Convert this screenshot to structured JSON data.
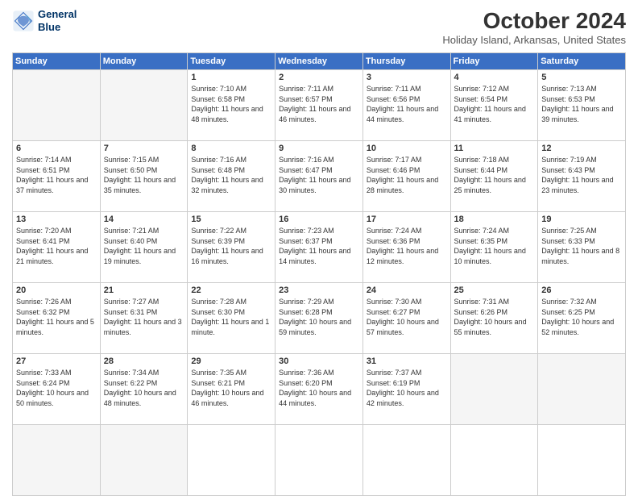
{
  "header": {
    "logo_line1": "General",
    "logo_line2": "Blue",
    "title": "October 2024",
    "location": "Holiday Island, Arkansas, United States"
  },
  "weekdays": [
    "Sunday",
    "Monday",
    "Tuesday",
    "Wednesday",
    "Thursday",
    "Friday",
    "Saturday"
  ],
  "days": [
    {
      "num": "",
      "info": ""
    },
    {
      "num": "",
      "info": ""
    },
    {
      "num": "1",
      "info": "Sunrise: 7:10 AM\nSunset: 6:58 PM\nDaylight: 11 hours and 48 minutes."
    },
    {
      "num": "2",
      "info": "Sunrise: 7:11 AM\nSunset: 6:57 PM\nDaylight: 11 hours and 46 minutes."
    },
    {
      "num": "3",
      "info": "Sunrise: 7:11 AM\nSunset: 6:56 PM\nDaylight: 11 hours and 44 minutes."
    },
    {
      "num": "4",
      "info": "Sunrise: 7:12 AM\nSunset: 6:54 PM\nDaylight: 11 hours and 41 minutes."
    },
    {
      "num": "5",
      "info": "Sunrise: 7:13 AM\nSunset: 6:53 PM\nDaylight: 11 hours and 39 minutes."
    },
    {
      "num": "6",
      "info": "Sunrise: 7:14 AM\nSunset: 6:51 PM\nDaylight: 11 hours and 37 minutes."
    },
    {
      "num": "7",
      "info": "Sunrise: 7:15 AM\nSunset: 6:50 PM\nDaylight: 11 hours and 35 minutes."
    },
    {
      "num": "8",
      "info": "Sunrise: 7:16 AM\nSunset: 6:48 PM\nDaylight: 11 hours and 32 minutes."
    },
    {
      "num": "9",
      "info": "Sunrise: 7:16 AM\nSunset: 6:47 PM\nDaylight: 11 hours and 30 minutes."
    },
    {
      "num": "10",
      "info": "Sunrise: 7:17 AM\nSunset: 6:46 PM\nDaylight: 11 hours and 28 minutes."
    },
    {
      "num": "11",
      "info": "Sunrise: 7:18 AM\nSunset: 6:44 PM\nDaylight: 11 hours and 25 minutes."
    },
    {
      "num": "12",
      "info": "Sunrise: 7:19 AM\nSunset: 6:43 PM\nDaylight: 11 hours and 23 minutes."
    },
    {
      "num": "13",
      "info": "Sunrise: 7:20 AM\nSunset: 6:41 PM\nDaylight: 11 hours and 21 minutes."
    },
    {
      "num": "14",
      "info": "Sunrise: 7:21 AM\nSunset: 6:40 PM\nDaylight: 11 hours and 19 minutes."
    },
    {
      "num": "15",
      "info": "Sunrise: 7:22 AM\nSunset: 6:39 PM\nDaylight: 11 hours and 16 minutes."
    },
    {
      "num": "16",
      "info": "Sunrise: 7:23 AM\nSunset: 6:37 PM\nDaylight: 11 hours and 14 minutes."
    },
    {
      "num": "17",
      "info": "Sunrise: 7:24 AM\nSunset: 6:36 PM\nDaylight: 11 hours and 12 minutes."
    },
    {
      "num": "18",
      "info": "Sunrise: 7:24 AM\nSunset: 6:35 PM\nDaylight: 11 hours and 10 minutes."
    },
    {
      "num": "19",
      "info": "Sunrise: 7:25 AM\nSunset: 6:33 PM\nDaylight: 11 hours and 8 minutes."
    },
    {
      "num": "20",
      "info": "Sunrise: 7:26 AM\nSunset: 6:32 PM\nDaylight: 11 hours and 5 minutes."
    },
    {
      "num": "21",
      "info": "Sunrise: 7:27 AM\nSunset: 6:31 PM\nDaylight: 11 hours and 3 minutes."
    },
    {
      "num": "22",
      "info": "Sunrise: 7:28 AM\nSunset: 6:30 PM\nDaylight: 11 hours and 1 minute."
    },
    {
      "num": "23",
      "info": "Sunrise: 7:29 AM\nSunset: 6:28 PM\nDaylight: 10 hours and 59 minutes."
    },
    {
      "num": "24",
      "info": "Sunrise: 7:30 AM\nSunset: 6:27 PM\nDaylight: 10 hours and 57 minutes."
    },
    {
      "num": "25",
      "info": "Sunrise: 7:31 AM\nSunset: 6:26 PM\nDaylight: 10 hours and 55 minutes."
    },
    {
      "num": "26",
      "info": "Sunrise: 7:32 AM\nSunset: 6:25 PM\nDaylight: 10 hours and 52 minutes."
    },
    {
      "num": "27",
      "info": "Sunrise: 7:33 AM\nSunset: 6:24 PM\nDaylight: 10 hours and 50 minutes."
    },
    {
      "num": "28",
      "info": "Sunrise: 7:34 AM\nSunset: 6:22 PM\nDaylight: 10 hours and 48 minutes."
    },
    {
      "num": "29",
      "info": "Sunrise: 7:35 AM\nSunset: 6:21 PM\nDaylight: 10 hours and 46 minutes."
    },
    {
      "num": "30",
      "info": "Sunrise: 7:36 AM\nSunset: 6:20 PM\nDaylight: 10 hours and 44 minutes."
    },
    {
      "num": "31",
      "info": "Sunrise: 7:37 AM\nSunset: 6:19 PM\nDaylight: 10 hours and 42 minutes."
    },
    {
      "num": "",
      "info": ""
    },
    {
      "num": "",
      "info": ""
    },
    {
      "num": "",
      "info": ""
    },
    {
      "num": "",
      "info": ""
    }
  ]
}
